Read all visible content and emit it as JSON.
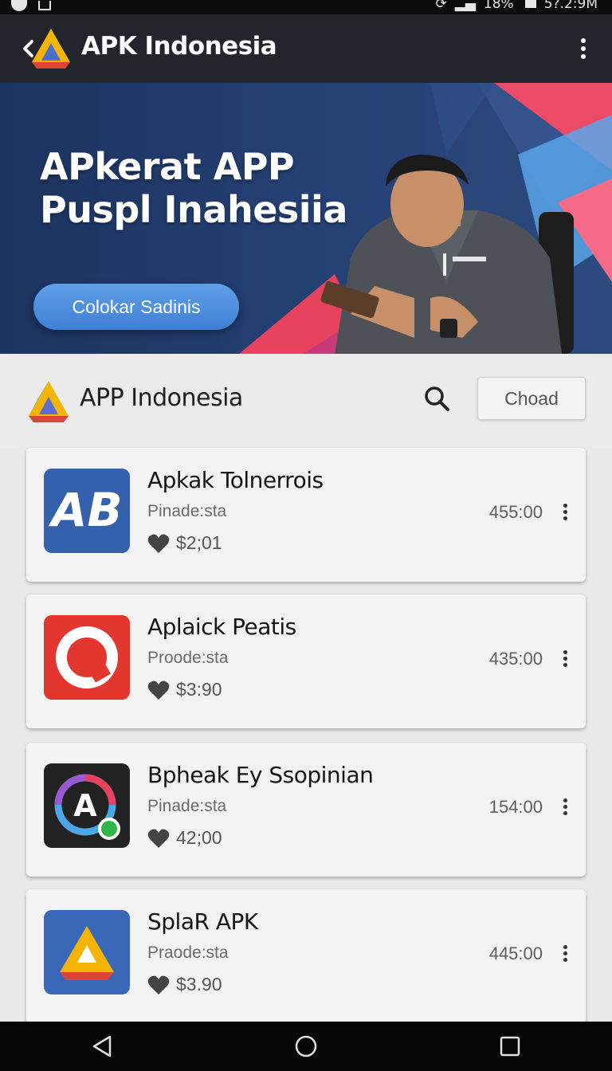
{
  "status_bar": {
    "battery": "18%",
    "time": "5?.2:9M"
  },
  "app_bar": {
    "title": "APK Indonesia"
  },
  "hero": {
    "title_line1": "APkerat APP",
    "title_line2": "Puspl Inahesiia",
    "cta_label": "Colokar Sadinis"
  },
  "section": {
    "title": "APP Indonesia",
    "button_label": "Choad"
  },
  "apps": [
    {
      "name": "Apkak Tolnerrois",
      "subtitle": "Pinade:sta",
      "price": "$2;01",
      "count": "455:00",
      "icon": "ab-logo-icon"
    },
    {
      "name": "Aplaick Peatis",
      "subtitle": "Proode:sta",
      "price": "$3:90",
      "count": "435:00",
      "icon": "red-ring-icon"
    },
    {
      "name": "Bpheak Ey Ssopinian",
      "subtitle": "Pinade:sta",
      "price": "42;00",
      "count": "154:00",
      "icon": "circle-a-icon"
    },
    {
      "name": "SplaR APK",
      "subtitle": "Praode:sta",
      "price": "$3.90",
      "count": "445:00",
      "icon": "triangle-drive-icon"
    }
  ],
  "colors": {
    "app_bar": "#22252b",
    "hero_bg": "#1d3360",
    "cta_blue": "#4a8ade",
    "accent_pink": "#e8435e"
  }
}
